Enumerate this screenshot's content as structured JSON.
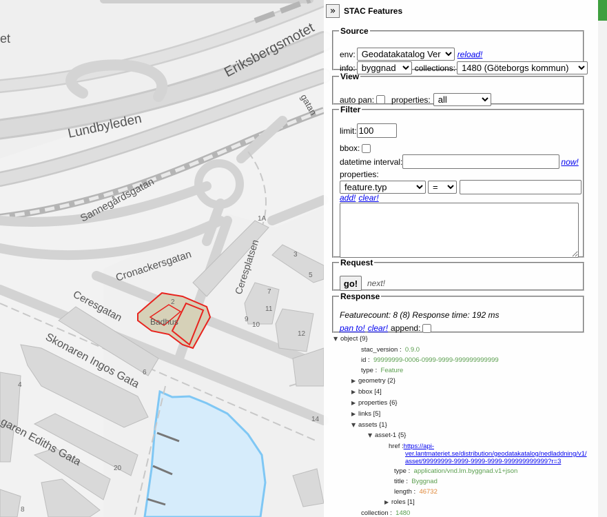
{
  "map": {
    "labels": {
      "eriksbergsmotet": "Eriksbergsmotet",
      "lundbyleden": "Lundbyleden",
      "sannegardsgatan": "Sannegårdsgatan",
      "cronackersgatan": "Cronackersgatan",
      "ceresplatsen": "Ceresplatsen",
      "ceresgatan": "Ceresgatan",
      "skonaren_ingos": "Skonaren Ingos Gata",
      "skonaren_ediths": "garen Ediths Gata",
      "partial_et": "et",
      "partial_gatan": "gatan",
      "badhus": "Badhus"
    },
    "house_numbers": {
      "n1a": "1A",
      "n3": "3",
      "n5": "5",
      "n7": "7",
      "n9": "9",
      "n10": "10",
      "n11": "11",
      "n12": "12",
      "n14": "14",
      "n2": "2",
      "n4": "4",
      "n6": "6",
      "n8": "8",
      "n20": "20"
    },
    "colors": {
      "water": "#d6ecfb",
      "water_edge": "#7fc7f4",
      "highlight": "#e8231e",
      "building": "#d9d9d9"
    }
  },
  "panel": {
    "title": "STAC Features",
    "collapse_icon": "»",
    "source": {
      "legend": "Source",
      "env_label": "env:",
      "env_value": "Geodatakatalog Ver",
      "reload": "reload!",
      "info_label": "info:",
      "info_value": "byggnad",
      "collections_label": "collections:",
      "collections_value": "1480 (Göteborgs kommun)"
    },
    "view": {
      "legend": "View",
      "autopan_label": "auto pan:",
      "properties_label": "properties:",
      "properties_value": "all"
    },
    "filter": {
      "legend": "Filter",
      "limit_label": "limit:",
      "limit_value": "100",
      "bbox_label": "bbox:",
      "datetime_label": "datetime interval:",
      "now": "now!",
      "properties_label": "properties:",
      "prop_field": "feature.typ",
      "prop_op": "=",
      "add": "add!",
      "clear": "clear!"
    },
    "request": {
      "legend": "Request",
      "go": "go!",
      "next": "next!"
    },
    "response": {
      "legend": "Response",
      "status": "Featurecount: 8 (8) Response time: 192 ms",
      "panto": "pan to!",
      "clear": "clear!",
      "append_label": "append:"
    }
  },
  "tree": {
    "object": "object",
    "object_cnt": "{9}",
    "stac_version_k": "stac_version",
    "stac_version_v": "0.9.0",
    "id_k": "id",
    "id_v": "99999999-0006-0999-9999-999999999999",
    "type_k": "type",
    "type_v": "Feature",
    "geometry_k": "geometry",
    "geometry_cnt": "{2}",
    "bbox_k": "bbox",
    "bbox_cnt": "[4]",
    "properties_k": "properties",
    "properties_cnt": "{6}",
    "links_k": "links",
    "links_cnt": "[5]",
    "assets_k": "assets",
    "assets_cnt": "{1}",
    "asset1_k": "asset-1",
    "asset1_cnt": "{5}",
    "href_k": "href",
    "href_v1": "https://api-",
    "href_v2": "ver.lantmateriet.se/distribution/geodatakatalog/nedladdning/v1/",
    "href_v3": "asset/99999999-9999-9999-9999-999999999999?r=3",
    "atype_k": "type",
    "atype_v": "application/vnd.lm.byggnad.v1+json",
    "title_k": "title",
    "title_v": "Byggnad",
    "length_k": "length",
    "length_v": "46732",
    "roles_k": "roles",
    "roles_cnt": "[1]",
    "collection_k": "collection",
    "collection_v": "1480"
  }
}
